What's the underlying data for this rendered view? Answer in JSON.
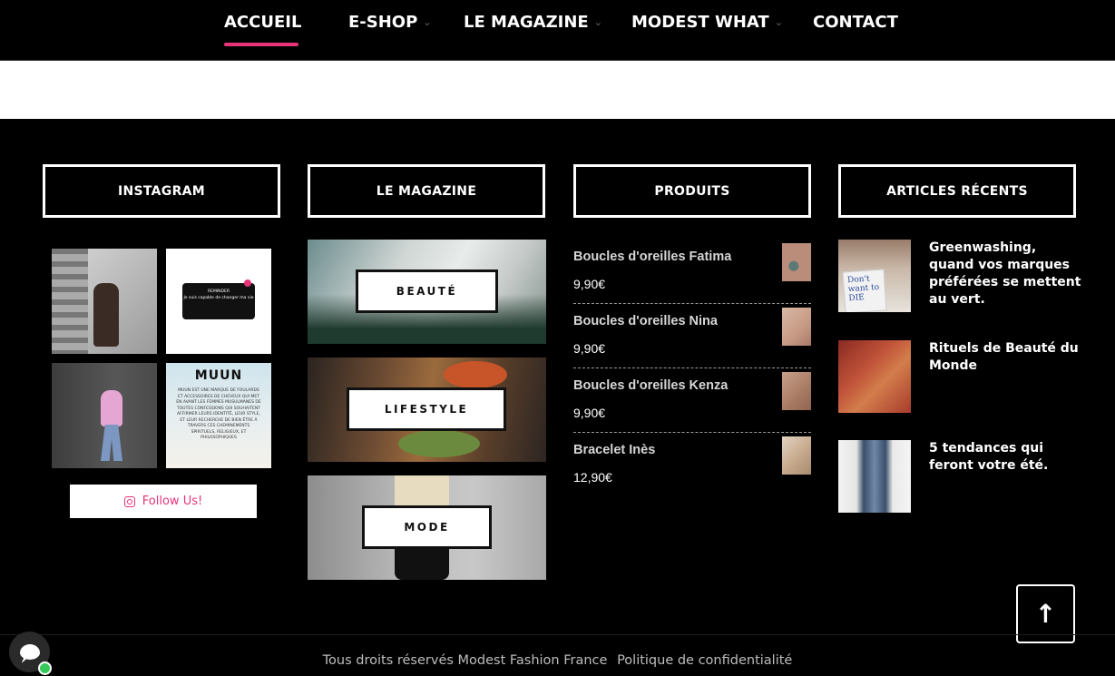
{
  "nav": {
    "items": [
      {
        "label": "ACCUEIL"
      },
      {
        "label": "E-SHOP"
      },
      {
        "label": "LE MAGAZINE"
      },
      {
        "label": "MODEST WHAT"
      },
      {
        "label": "CONTACT"
      }
    ],
    "chevron_icon": "chevron-down-icon",
    "accent_color": "#e8337a"
  },
  "widgets": {
    "instagram": {
      "title": "INSTAGRAM",
      "follow_label": "Follow Us!",
      "post2_card": "REMINDER\nJe suis capable de changer ma vie",
      "post4_title": "MUUN",
      "post4_text": "MUUN EST UNE MARQUE DE FOULARDS ET ACCESSOIRES DE CHEVEUX QUI MET EN AVANT LES FEMMES MUSULMANES DE TOUTES CONFESSIONS QUI SOUHAITENT AFFIRMER LEURS IDENTITÉ, LEUR STYLE, ET LEUR RECHERCHE DE BIEN ÊTRE À TRAVERS CES CHEMINEMENTS SPIRITUELS, RELIGIEUX, ET PHILOSOPHIQUES"
    },
    "magazine": {
      "title": "LE MAGAZINE",
      "tiles": [
        {
          "label": "BEAUTÉ"
        },
        {
          "label": "LIFESTYLE"
        },
        {
          "label": "MODE"
        }
      ]
    },
    "products": {
      "title": "PRODUITS",
      "items": [
        {
          "name": "Boucles d'oreilles Fatima",
          "price": "9,90€"
        },
        {
          "name": "Boucles d'oreilles Nina",
          "price": "9,90€"
        },
        {
          "name": "Boucles d'oreilles Kenza",
          "price": "9,90€"
        },
        {
          "name": "Bracelet Inès",
          "price": "12,90€"
        }
      ]
    },
    "articles": {
      "title": "ARTICLES RÉCENTS",
      "items": [
        {
          "title": "Greenwashing, quand vos marques préférées se mettent au vert.",
          "image_text": "Don't want to DIE"
        },
        {
          "title": "Rituels de Beauté du Monde"
        },
        {
          "title": "5 tendances qui feront votre été."
        }
      ]
    }
  },
  "footer": {
    "copyright": "Tous droits réservés Modest Fashion France",
    "privacy_link": "Politique de confidentialité"
  },
  "back_to_top_icon": "arrow-up-icon",
  "chat_icon": "chat-bubble-icon"
}
